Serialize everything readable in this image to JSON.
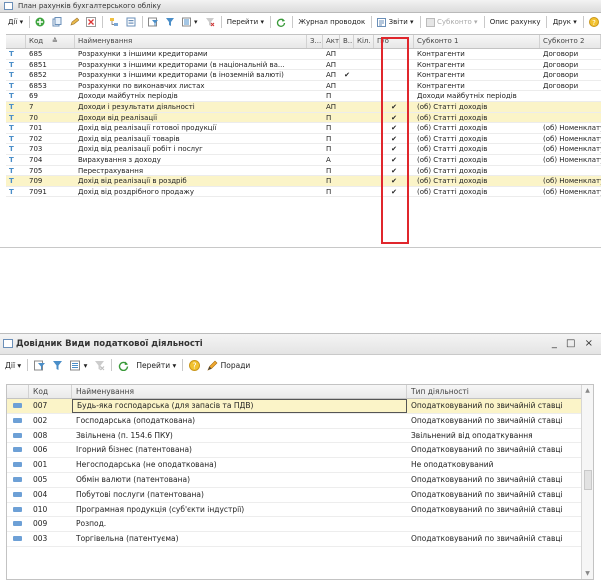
{
  "top_window": {
    "title": "План рахунків бухгалтерського обліку",
    "toolbar": {
      "actions": "Дії",
      "goto": "Перейти",
      "journal": "Журнал проводок",
      "reports": "Звіти",
      "subconto": "Субконто",
      "account_desc": "Опис рахунку",
      "print": "Друк"
    },
    "columns": [
      "Код",
      "Найменування",
      "З...",
      "Акт.",
      "В...",
      "Кіл.",
      "П/о",
      "Субконто 1",
      "Субконто 2"
    ],
    "rows": [
      {
        "code": "685",
        "name": "Розрахунки з іншими кредиторами",
        "act": "АП",
        "v": "",
        "po": "",
        "sub1": "Контрагенти",
        "sub2": "Договори",
        "hl": false
      },
      {
        "code": "6851",
        "name": "Розрахунки з іншими кредиторами (в національній ва...",
        "act": "АП",
        "v": "",
        "po": "",
        "sub1": "Контрагенти",
        "sub2": "Договори",
        "hl": false
      },
      {
        "code": "6852",
        "name": "Розрахунки з іншими кредиторами (в іноземній валюті)",
        "act": "АП",
        "v": "✔",
        "po": "",
        "sub1": "Контрагенти",
        "sub2": "Договори",
        "hl": false
      },
      {
        "code": "6853",
        "name": "Розрахунки по виконавчих листах",
        "act": "АП",
        "v": "",
        "po": "",
        "sub1": "Контрагенти",
        "sub2": "Договори",
        "hl": false
      },
      {
        "code": "69",
        "name": "Доходи майбутніх періодів",
        "act": "П",
        "v": "",
        "po": "",
        "sub1": "Доходи майбутніх періодів",
        "sub2": "",
        "hl": false
      },
      {
        "code": "7",
        "name": "Доходи і результати діяльності",
        "act": "АП",
        "v": "",
        "po": "✔",
        "sub1": "(об) Статті доходів",
        "sub2": "",
        "hl": true
      },
      {
        "code": "70",
        "name": "Доходи від реалізації",
        "act": "П",
        "v": "",
        "po": "✔",
        "sub1": "(об) Статті доходів",
        "sub2": "",
        "hl": true
      },
      {
        "code": "701",
        "name": "Дохід від реалізації готової продукції",
        "act": "П",
        "v": "",
        "po": "✔",
        "sub1": "(об) Статті доходів",
        "sub2": "(об) Номенклату",
        "hl": false
      },
      {
        "code": "702",
        "name": "Дохід від реалізації товарів",
        "act": "П",
        "v": "",
        "po": "✔",
        "sub1": "(об) Статті доходів",
        "sub2": "(об) Номенклату",
        "hl": false
      },
      {
        "code": "703",
        "name": "Дохід від реалізації робіт і послуг",
        "act": "П",
        "v": "",
        "po": "✔",
        "sub1": "(об) Статті доходів",
        "sub2": "(об) Номенклату",
        "hl": false
      },
      {
        "code": "704",
        "name": "Вирахування з доходу",
        "act": "А",
        "v": "",
        "po": "✔",
        "sub1": "(об) Статті доходів",
        "sub2": "(об) Номенклату",
        "hl": false
      },
      {
        "code": "705",
        "name": "Перестрахування",
        "act": "П",
        "v": "",
        "po": "✔",
        "sub1": "(об) Статті доходів",
        "sub2": "",
        "hl": false
      },
      {
        "code": "709",
        "name": "Дохід від реалізації в роздріб",
        "act": "П",
        "v": "",
        "po": "✔",
        "sub1": "(об) Статті доходів",
        "sub2": "(об) Номенклату",
        "hl": true
      },
      {
        "code": "7091",
        "name": "Дохід від роздрібного продажу",
        "act": "П",
        "v": "",
        "po": "✔",
        "sub1": "(об) Статті доходів",
        "sub2": "(об) Номенклату",
        "hl": false
      }
    ],
    "highlight_color": "#e0262c"
  },
  "bottom_window": {
    "title": "Довідник Види податкової діяльності",
    "window_controls": "_ □ ×",
    "toolbar": {
      "actions": "Дії",
      "goto": "Перейти",
      "help": "Поради"
    },
    "columns": [
      "Код",
      "Найменування",
      "Тип діяльності"
    ],
    "rows": [
      {
        "code": "007",
        "name": "Будь-яка господарська (для запасів та ПДВ)",
        "type": "Оподатковуваний по звичайній ставці",
        "sel": true
      },
      {
        "code": "002",
        "name": "Господарська (оподаткована)",
        "type": "Оподатковуваний по звичайній ставці",
        "sel": false
      },
      {
        "code": "008",
        "name": "Звільнена (п. 154.6 ПКУ)",
        "type": "Звільнений від оподаткування",
        "sel": false
      },
      {
        "code": "006",
        "name": "Ігорний бізнес (патентована)",
        "type": "Оподатковуваний по звичайній ставці",
        "sel": false
      },
      {
        "code": "001",
        "name": "Негосподарська (не оподаткована)",
        "type": "Не оподатковуваний",
        "sel": false
      },
      {
        "code": "005",
        "name": "Обмін валюти (патентована)",
        "type": "Оподатковуваний по звичайній ставці",
        "sel": false
      },
      {
        "code": "004",
        "name": "Побутові послуги (патентована)",
        "type": "Оподатковуваний по звичайній ставці",
        "sel": false
      },
      {
        "code": "010",
        "name": "Програмная продукція (суб'єкти індустрії)",
        "type": "Оподатковуваний по звичайній ставці",
        "sel": false
      },
      {
        "code": "009",
        "name": "Розпод.",
        "type": "",
        "sel": false
      },
      {
        "code": "003",
        "name": "Торгівельна (патентуєма)",
        "type": "Оподатковуваний по звичайній ставці",
        "sel": false
      }
    ]
  }
}
